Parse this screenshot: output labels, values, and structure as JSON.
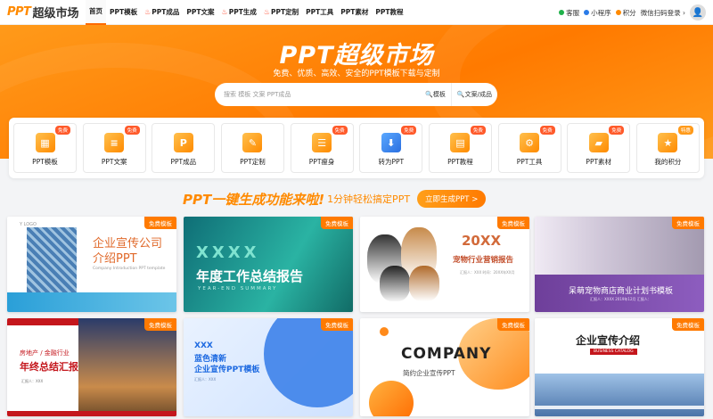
{
  "logo": {
    "ppt": "PPT",
    "text": "超级市场"
  },
  "nav": {
    "items": [
      {
        "label": "首页",
        "fire": false,
        "active": true
      },
      {
        "label": "PPT模板",
        "fire": false,
        "active": false
      },
      {
        "label": "PPT成品",
        "fire": true,
        "active": false
      },
      {
        "label": "PPT文案",
        "fire": false,
        "active": false
      },
      {
        "label": "PPT生成",
        "fire": true,
        "active": false
      },
      {
        "label": "PPT定制",
        "fire": true,
        "active": false
      },
      {
        "label": "PPT工具",
        "fire": false,
        "active": false
      },
      {
        "label": "PPT素材",
        "fire": false,
        "active": false
      },
      {
        "label": "PPT教程",
        "fire": false,
        "active": false
      }
    ],
    "right": {
      "service": "客服",
      "mini": "小程序",
      "points": "积分",
      "login": "微信扫码登录 ›",
      "service_color": "#1fb14a",
      "mini_color": "#2a7be8",
      "points_color": "#ff8a00"
    }
  },
  "hero": {
    "title": "PPT超级市场",
    "subtitle": "免费、优质、高效、安全的PPT模板下载与定制",
    "search_placeholder": "搜索 模板 文案 PPT成品",
    "search_btn_template": "模板",
    "search_btn_doc": "文案/成品"
  },
  "categories": [
    {
      "label": "PPT模板",
      "tag": "免费",
      "icon": "grid-icon"
    },
    {
      "label": "PPT文案",
      "tag": "免费",
      "icon": "doc-icon"
    },
    {
      "label": "PPT成品",
      "tag": "",
      "icon": "p-icon"
    },
    {
      "label": "PPT定制",
      "tag": "",
      "icon": "ruler-icon"
    },
    {
      "label": "PPT瘦身",
      "tag": "免费",
      "icon": "slim-icon"
    },
    {
      "label": "转为PPT",
      "tag": "免费",
      "icon": "download-icon"
    },
    {
      "label": "PPT教程",
      "tag": "免费",
      "icon": "tutorial-icon"
    },
    {
      "label": "PPT工具",
      "tag": "免费",
      "icon": "tool-icon"
    },
    {
      "label": "PPT素材",
      "tag": "免费",
      "icon": "folder-icon"
    },
    {
      "label": "我的积分",
      "tag": "特惠",
      "icon": "badge-icon"
    }
  ],
  "promo": {
    "title": "PPT一键生成功能来啦!",
    "text": "1分钟轻松搞定PPT",
    "button": "立即生成PPT >"
  },
  "cards": [
    {
      "badge": "免费模板",
      "title1": "企业宣传公司",
      "title2": "介绍PPT",
      "sub": "Company Introduction PPT template",
      "logo": "Y LOGO"
    },
    {
      "badge": "免费模板",
      "title1": "XXXX",
      "title2": "年度工作总结报告",
      "sub": "YEAR-END SUMMARY"
    },
    {
      "badge": "免费模板",
      "title1": "20XX",
      "title2": "宠物行业营销报告",
      "sub": "汇报人：XXX  时间：20XX年XX月"
    },
    {
      "badge": "免费模板",
      "title1": "呆萌宠物商店商业计划书模板",
      "sub": "汇报人：XXXX    2019年12月    汇报人："
    },
    {
      "badge": "免费模板",
      "title1": "房地产 / 金融行业",
      "title2": "年终总结汇报",
      "sub": "汇报人：XXX"
    },
    {
      "badge": "免费模板",
      "title1": "XXX",
      "title2": "蓝色清新",
      "title3": "企业宣传PPT模板",
      "sub": "汇报人：XXX"
    },
    {
      "badge": "免费模板",
      "title1": "COMPANY",
      "title2": "简约企业宣传PPT"
    },
    {
      "badge": "免费模板",
      "title1": "企业宣传介绍",
      "title2": "BUSINESS CATALOG"
    }
  ]
}
